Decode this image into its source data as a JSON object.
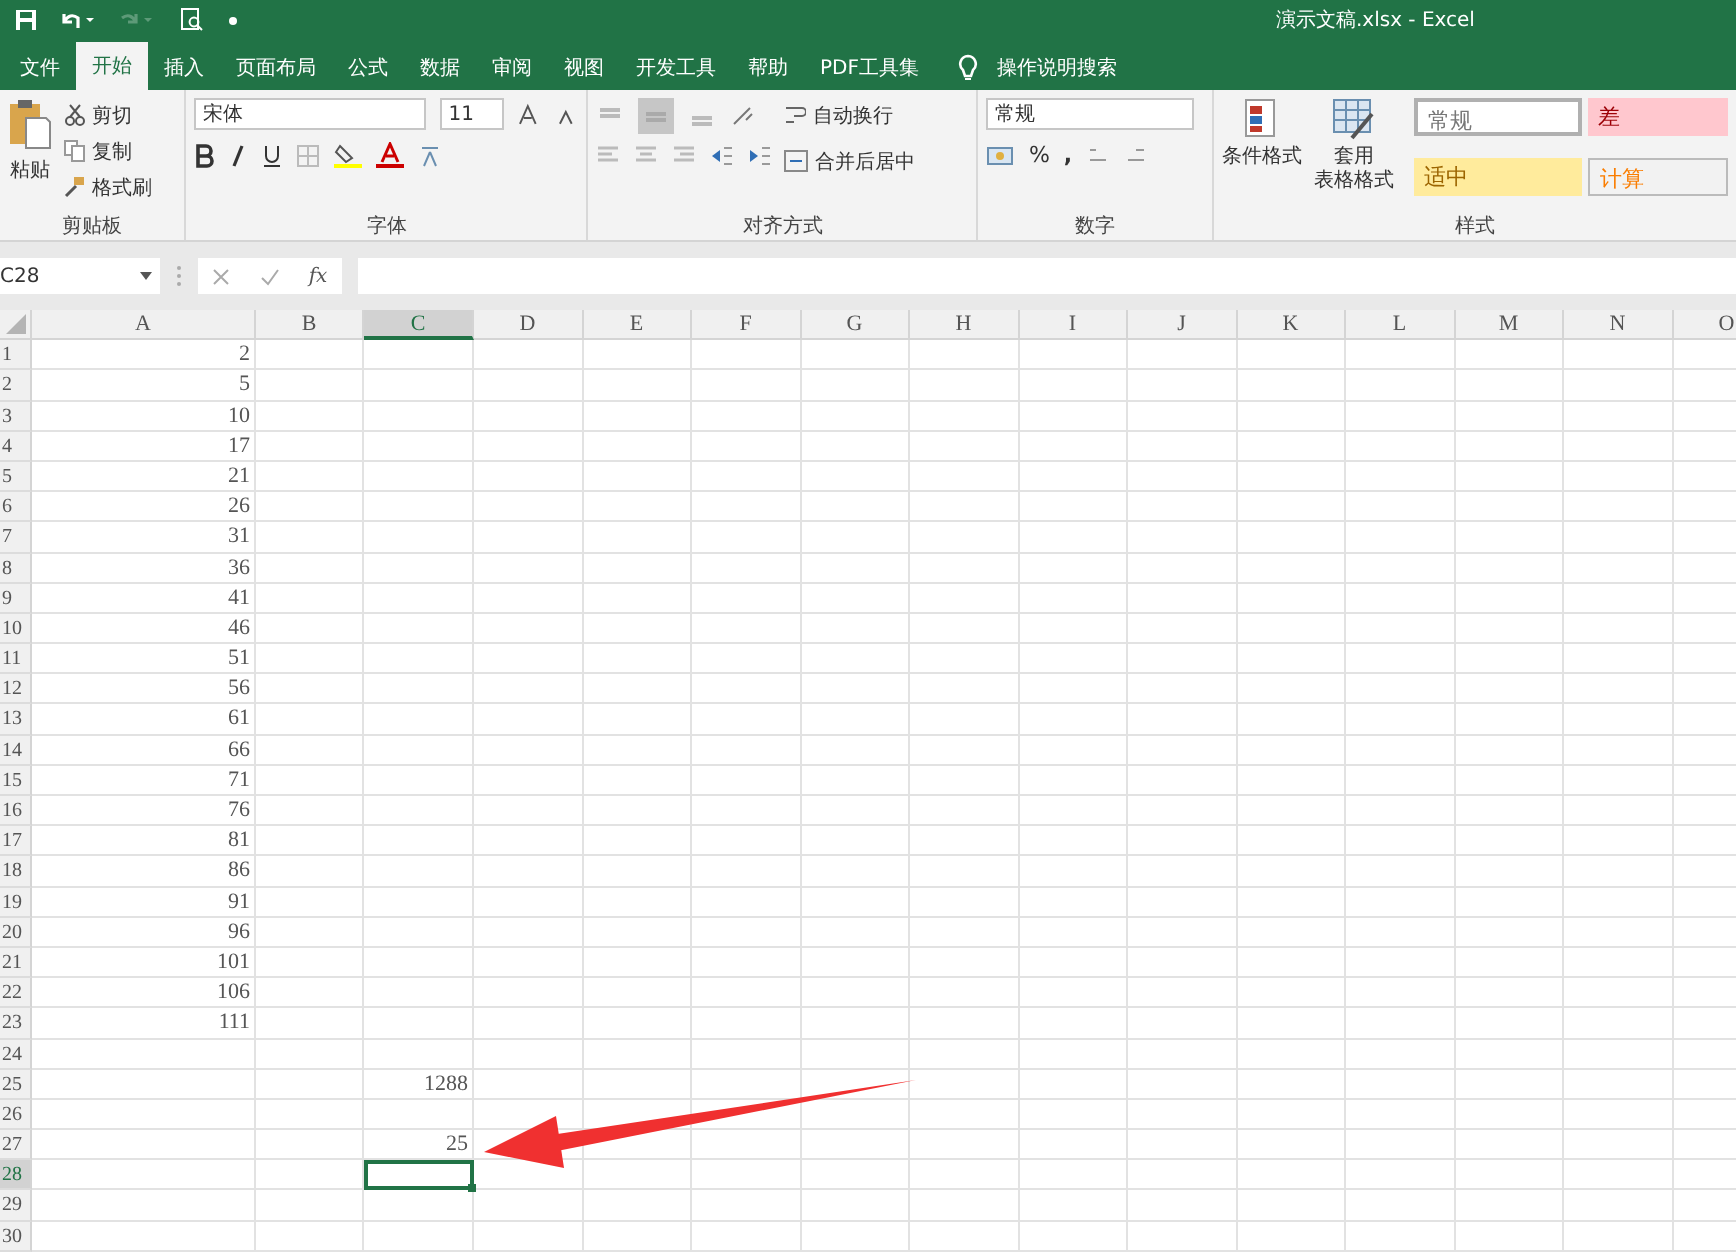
{
  "window": {
    "title": "演示文稿.xlsx  -  Excel"
  },
  "tabs": [
    {
      "label": "文件",
      "selected": false
    },
    {
      "label": "开始",
      "selected": true
    },
    {
      "label": "插入",
      "selected": false
    },
    {
      "label": "页面布局",
      "selected": false
    },
    {
      "label": "公式",
      "selected": false
    },
    {
      "label": "数据",
      "selected": false
    },
    {
      "label": "审阅",
      "selected": false
    },
    {
      "label": "视图",
      "selected": false
    },
    {
      "label": "开发工具",
      "selected": false
    },
    {
      "label": "帮助",
      "selected": false
    },
    {
      "label": "PDF工具集",
      "selected": false
    }
  ],
  "search": {
    "placeholder": "操作说明搜索"
  },
  "ribbon": {
    "clipboard": {
      "label": "剪贴板",
      "paste": "粘贴",
      "cut": "剪切",
      "copy": "复制",
      "format_painter": "格式刷"
    },
    "font": {
      "label": "字体",
      "family": "宋体",
      "size": "11"
    },
    "alignment": {
      "label": "对齐方式",
      "wrap": "自动换行",
      "merge": "合并后居中"
    },
    "number": {
      "label": "数字",
      "format": "常规",
      "percent": "%",
      "comma": ","
    },
    "styles": {
      "label": "样式",
      "conditional": "条件格式",
      "table_line1": "套用",
      "table_line2": "表格格式",
      "cells": [
        {
          "text": "常规",
          "color": "#ffffff"
        },
        {
          "text": "差",
          "color": "#ffc7ce"
        },
        {
          "text": "适中",
          "color": "#ffeb9c"
        },
        {
          "text": "计算",
          "color": "#f2f2f2"
        }
      ]
    }
  },
  "formula_bar": {
    "name_box": "C28",
    "fx": "fx"
  },
  "columns": [
    {
      "label": "A",
      "selected": false
    },
    {
      "label": "B",
      "selected": false
    },
    {
      "label": "C",
      "selected": true
    },
    {
      "label": "D",
      "selected": false
    },
    {
      "label": "E",
      "selected": false
    },
    {
      "label": "F",
      "selected": false
    },
    {
      "label": "G",
      "selected": false
    },
    {
      "label": "H",
      "selected": false
    },
    {
      "label": "I",
      "selected": false
    },
    {
      "label": "J",
      "selected": false
    },
    {
      "label": "K",
      "selected": false
    },
    {
      "label": "L",
      "selected": false
    },
    {
      "label": "M",
      "selected": false
    },
    {
      "label": "N",
      "selected": false
    },
    {
      "label": "O",
      "selected": false
    }
  ],
  "rows": [
    {
      "label": "1",
      "selected": false,
      "cells": [
        "2"
      ]
    },
    {
      "label": "2",
      "selected": false,
      "cells": [
        "5"
      ]
    },
    {
      "label": "3",
      "selected": false,
      "cells": [
        "10"
      ]
    },
    {
      "label": "4",
      "selected": false,
      "cells": [
        "17"
      ]
    },
    {
      "label": "5",
      "selected": false,
      "cells": [
        "21"
      ]
    },
    {
      "label": "6",
      "selected": false,
      "cells": [
        "26"
      ]
    },
    {
      "label": "7",
      "selected": false,
      "cells": [
        "31"
      ]
    },
    {
      "label": "8",
      "selected": false,
      "cells": [
        "36"
      ]
    },
    {
      "label": "9",
      "selected": false,
      "cells": [
        "41"
      ]
    },
    {
      "label": "10",
      "selected": false,
      "cells": [
        "46"
      ]
    },
    {
      "label": "11",
      "selected": false,
      "cells": [
        "51"
      ]
    },
    {
      "label": "12",
      "selected": false,
      "cells": [
        "56"
      ]
    },
    {
      "label": "13",
      "selected": false,
      "cells": [
        "61"
      ]
    },
    {
      "label": "14",
      "selected": false,
      "cells": [
        "66"
      ]
    },
    {
      "label": "15",
      "selected": false,
      "cells": [
        "71"
      ]
    },
    {
      "label": "16",
      "selected": false,
      "cells": [
        "76"
      ]
    },
    {
      "label": "17",
      "selected": false,
      "cells": [
        "81"
      ]
    },
    {
      "label": "18",
      "selected": false,
      "cells": [
        "86"
      ]
    },
    {
      "label": "19",
      "selected": false,
      "cells": [
        "91"
      ]
    },
    {
      "label": "20",
      "selected": false,
      "cells": [
        "96"
      ]
    },
    {
      "label": "21",
      "selected": false,
      "cells": [
        "101"
      ]
    },
    {
      "label": "22",
      "selected": false,
      "cells": [
        "106"
      ]
    },
    {
      "label": "23",
      "selected": false,
      "cells": [
        "111"
      ]
    },
    {
      "label": "24",
      "selected": false,
      "cells": []
    },
    {
      "label": "25",
      "selected": false,
      "cells": [
        null,
        null,
        "1288"
      ]
    },
    {
      "label": "26",
      "selected": false,
      "cells": []
    },
    {
      "label": "27",
      "selected": false,
      "cells": [
        null,
        null,
        "25"
      ]
    },
    {
      "label": "28",
      "selected": true,
      "cells": []
    },
    {
      "label": "29",
      "selected": false,
      "cells": []
    },
    {
      "label": "30",
      "selected": false,
      "cells": []
    }
  ]
}
